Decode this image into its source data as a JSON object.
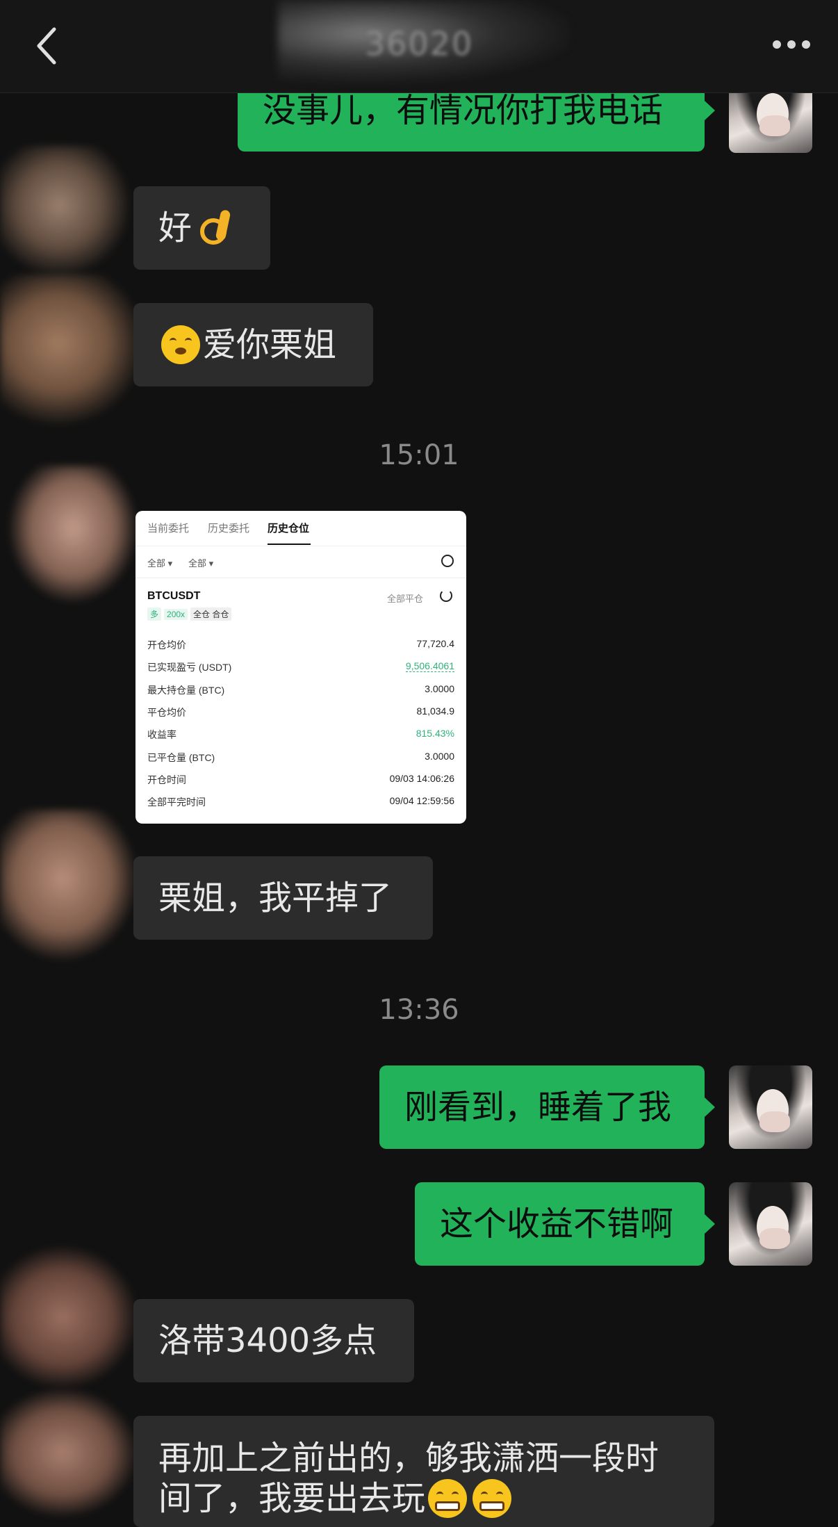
{
  "header": {
    "title": "36020"
  },
  "messages": {
    "m1": "没事儿，有情况你打我电话",
    "m2_text": "好",
    "m3_text": "爱你栗姐",
    "time1": "15:01",
    "m5": "栗姐，我平掉了",
    "time2": "13:36",
    "m6": "刚看到，睡着了我",
    "m7": "这个收益不错啊",
    "m8": "洛带3400多点",
    "m9_line1": "再加上之前出的，够我潇洒一段时",
    "m9_line2": "间了，我要出去玩"
  },
  "screenshot": {
    "tabs": [
      "当前委托",
      "历史委托",
      "历史仓位"
    ],
    "filters": [
      "全部 ▾",
      "全部 ▾"
    ],
    "symbol": "BTCUSDT",
    "close_all": "全部平仓",
    "tags": [
      "多",
      "200x",
      "全仓 合仓"
    ],
    "rows": [
      {
        "k": "开仓均价",
        "v": "77,720.4"
      },
      {
        "k": "已实现盈亏 (USDT)",
        "v": "9,506.4061"
      },
      {
        "k": "最大持仓量 (BTC)",
        "v": "3.0000"
      },
      {
        "k": "平仓均价",
        "v": "81,034.9"
      },
      {
        "k": "收益率",
        "v": "815.43%"
      },
      {
        "k": "已平仓量 (BTC)",
        "v": "3.0000"
      },
      {
        "k": "开仓时间",
        "v": "09/03 14:06:26"
      },
      {
        "k": "全部平完时间",
        "v": "09/04 12:59:56"
      }
    ]
  },
  "icons": {
    "back": "chevron-left-icon",
    "more": "more-dots-icon",
    "ok": "ok-hand-emoji",
    "kiss": "kissing-face-emoji",
    "grin": "grinning-face-emoji"
  },
  "colors": {
    "out_bubble": "#21b25a",
    "in_bubble": "#2c2c2c",
    "background": "#111111",
    "profit_green": "#2db37c"
  }
}
